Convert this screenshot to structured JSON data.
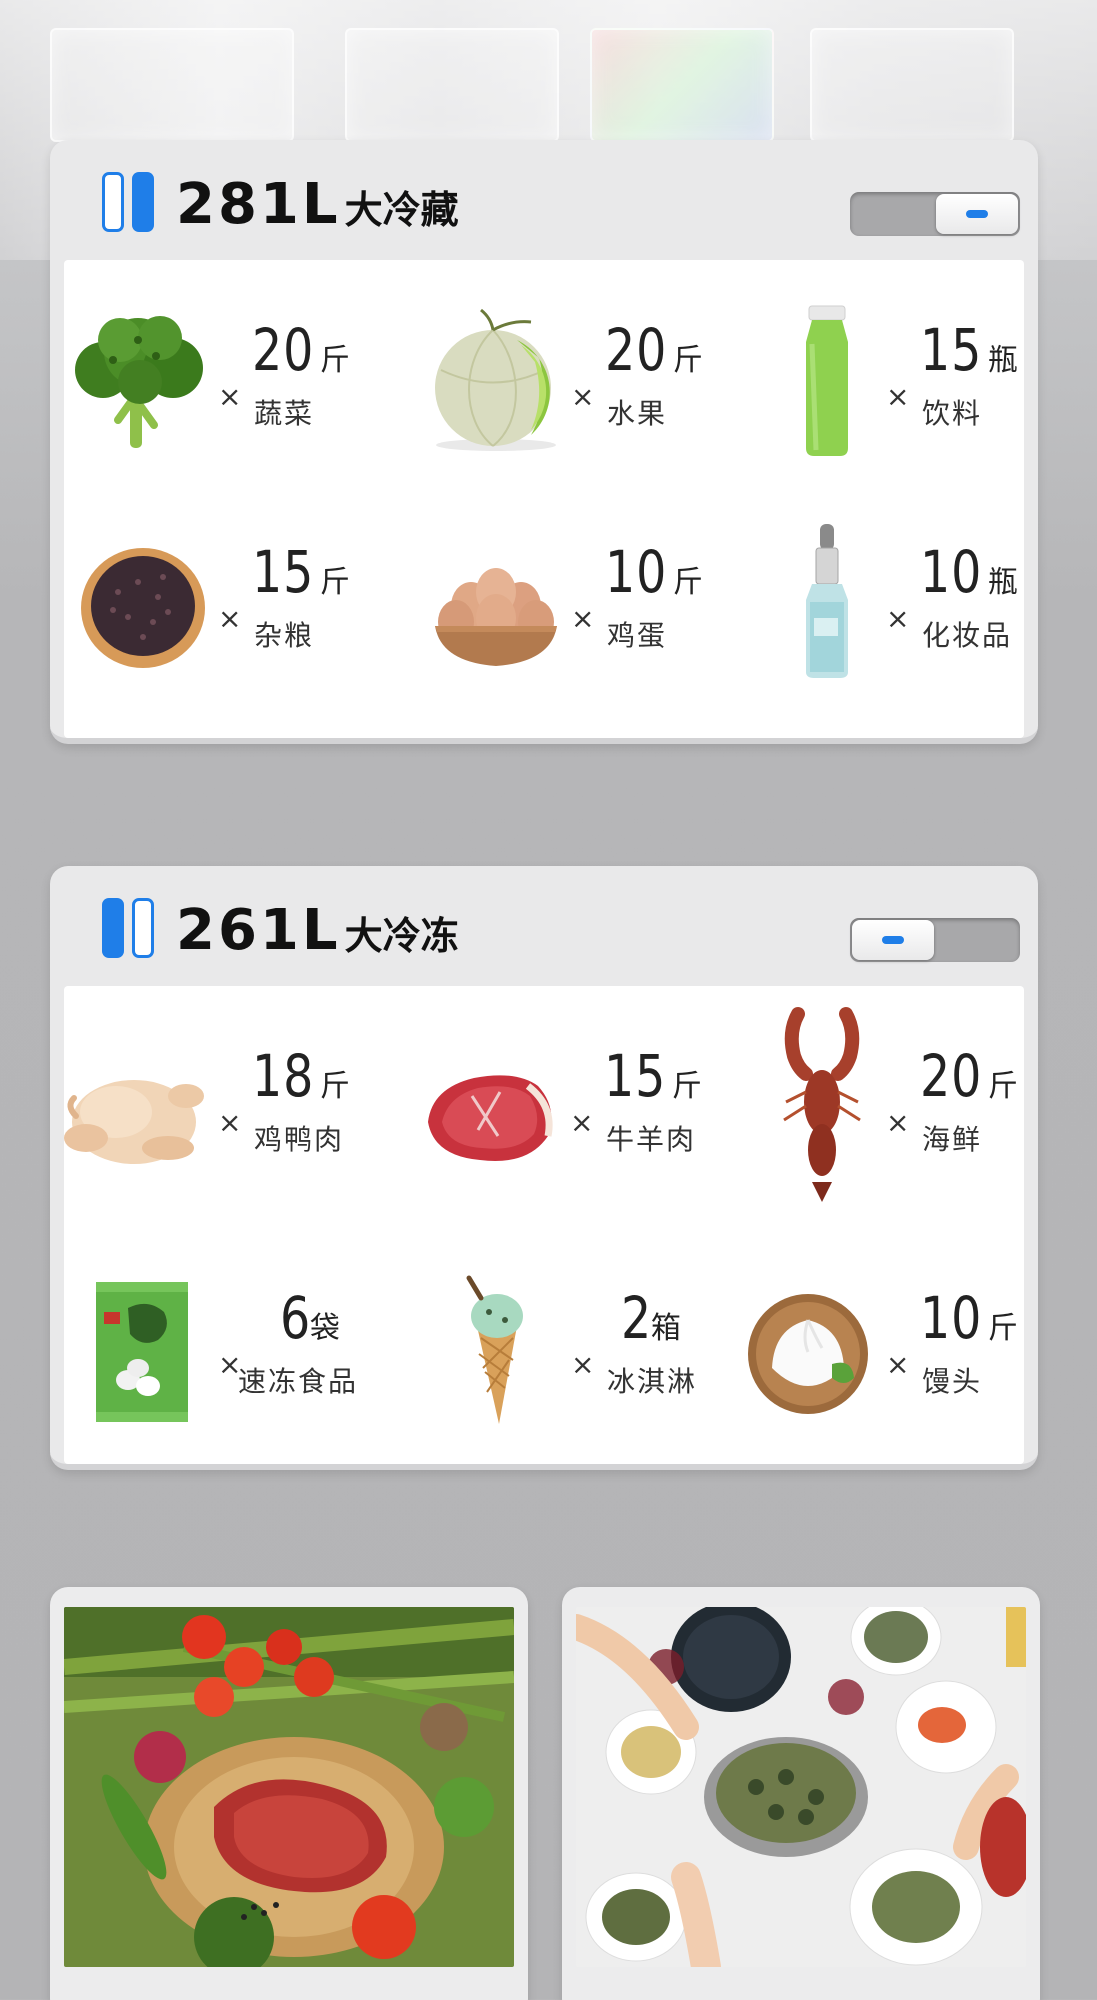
{
  "fridge": {
    "title_number": "281L",
    "title_label": "大冷藏",
    "toggle_state": "right",
    "items": [
      {
        "qty": "20",
        "unit": "斤",
        "name": "蔬菜",
        "icon": "broccoli-icon"
      },
      {
        "qty": "20",
        "unit": "斤",
        "name": "水果",
        "icon": "melon-icon"
      },
      {
        "qty": "15",
        "unit": "瓶",
        "name": "饮料",
        "icon": "juice-bottle-icon"
      },
      {
        "qty": "15",
        "unit": "斤",
        "name": "杂粮",
        "icon": "grain-bowl-icon"
      },
      {
        "qty": "10",
        "unit": "斤",
        "name": "鸡蛋",
        "icon": "egg-bowl-icon"
      },
      {
        "qty": "10",
        "unit": "瓶",
        "name": "化妆品",
        "icon": "serum-bottle-icon"
      }
    ]
  },
  "freezer": {
    "title_number": "261L",
    "title_label": "大冷冻",
    "toggle_state": "left",
    "items": [
      {
        "qty": "18",
        "unit": "斤",
        "name": "鸡鸭肉",
        "icon": "chicken-icon"
      },
      {
        "qty": "15",
        "unit": "斤",
        "name": "牛羊肉",
        "icon": "steak-icon"
      },
      {
        "qty": "20",
        "unit": "斤",
        "name": "海鲜",
        "icon": "lobster-icon"
      },
      {
        "qty": "6",
        "unit": "袋",
        "name": "速冻食品",
        "icon": "frozen-bag-icon"
      },
      {
        "qty": "2",
        "unit": "箱",
        "name": "冰淇淋",
        "icon": "ice-cream-icon"
      },
      {
        "qty": "10",
        "unit": "斤",
        "name": "馒头",
        "icon": "bun-icon"
      }
    ]
  },
  "common": {
    "times_symbol": "×"
  },
  "colors": {
    "accent_blue": "#1f7ee8",
    "panel_bg": "#e9e9ea",
    "page_bg": "#b6b6b8"
  },
  "photos": [
    {
      "icon": "steak-vegetables-photo"
    },
    {
      "icon": "seafood-dinner-photo"
    }
  ]
}
